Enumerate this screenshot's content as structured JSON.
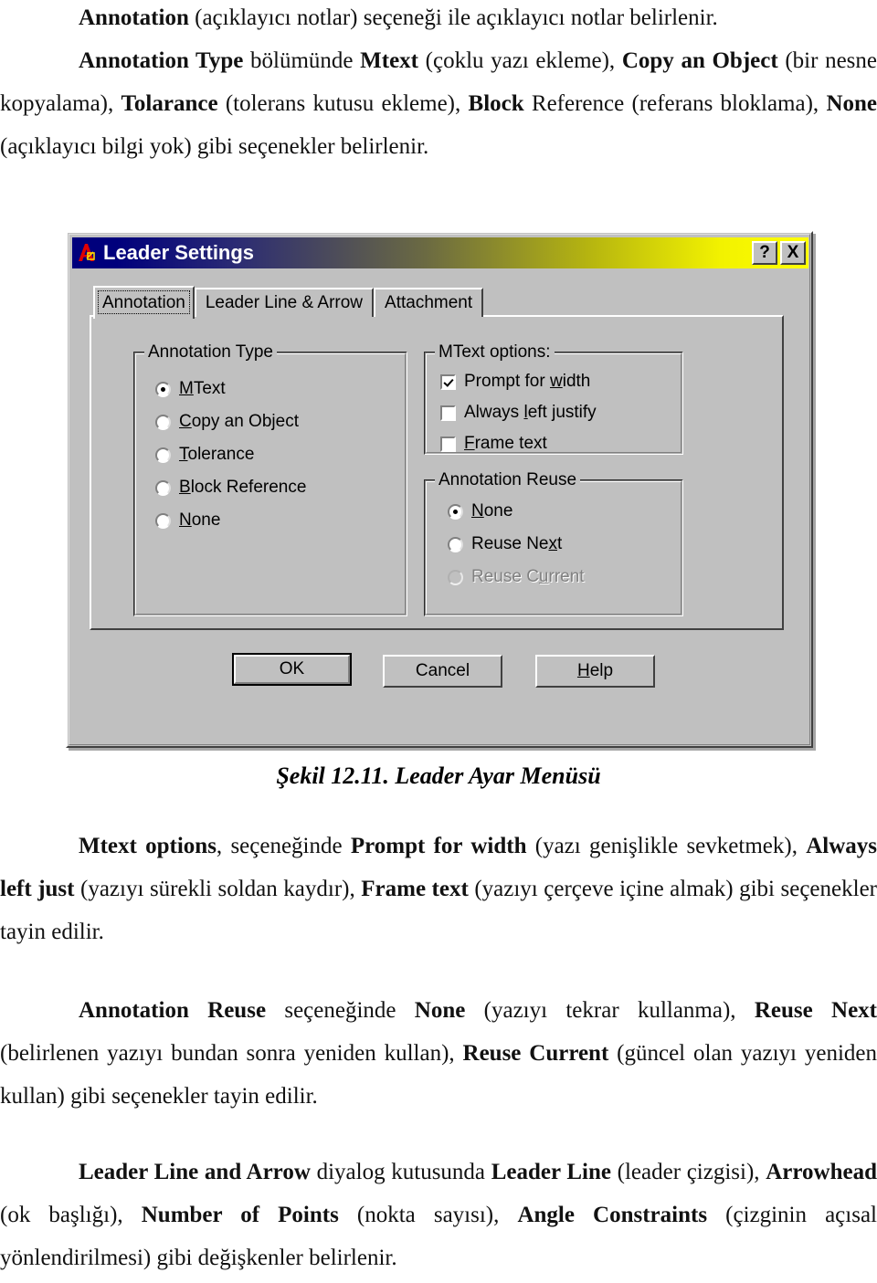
{
  "document": {
    "paragraphs": [
      {
        "id": "p1",
        "runs": [
          {
            "t": "Annotation",
            "b": true
          },
          {
            "t": " (açıklayıcı notlar) seçeneği ile açıklayıcı notlar belirlenir.",
            "b": false
          }
        ]
      },
      {
        "id": "p2",
        "runs": [
          {
            "t": "Annotation Type",
            "b": true
          },
          {
            "t": " bölümünde ",
            "b": false
          },
          {
            "t": "Mtext",
            "b": true
          },
          {
            "t": " (çoklu yazı ekleme), ",
            "b": false
          },
          {
            "t": "Copy an Object",
            "b": true
          },
          {
            "t": " (bir nesne kopyalama), ",
            "b": false
          },
          {
            "t": "Tolarance",
            "b": true
          },
          {
            "t": " (tolerans kutusu ekleme), ",
            "b": false
          },
          {
            "t": "Block",
            "b": true
          },
          {
            "t": " Reference (referans bloklama), ",
            "b": false
          },
          {
            "t": "None",
            "b": true
          },
          {
            "t": " (açıklayıcı bilgi yok) gibi seçenekler belirlenir.",
            "b": false
          }
        ]
      },
      {
        "id": "p3",
        "runs": [
          {
            "t": "Mtext options",
            "b": true
          },
          {
            "t": ", seçeneğinde ",
            "b": false
          },
          {
            "t": "Prompt for width",
            "b": true
          },
          {
            "t": " (yazı genişlikle sevketmek), ",
            "b": false
          },
          {
            "t": "Always left just",
            "b": true
          },
          {
            "t": " (yazıyı sürekli soldan kaydır), ",
            "b": false
          },
          {
            "t": "Frame text",
            "b": true
          },
          {
            "t": " (yazıyı çerçeve içine almak)  gibi seçenekler tayin edilir.",
            "b": false
          }
        ]
      },
      {
        "id": "p4",
        "runs": [
          {
            "t": "Annotation Reuse",
            "b": true
          },
          {
            "t": " seçeneğinde ",
            "b": false
          },
          {
            "t": "None",
            "b": true
          },
          {
            "t": " (yazıyı tekrar kullanma), ",
            "b": false
          },
          {
            "t": "Reuse Next",
            "b": true
          },
          {
            "t": " (belirlenen yazıyı bundan sonra yeniden kullan), ",
            "b": false
          },
          {
            "t": "Reuse Current",
            "b": true
          },
          {
            "t": " (güncel olan yazıyı yeniden kullan) gibi seçenekler tayin edilir.",
            "b": false
          }
        ]
      },
      {
        "id": "p5",
        "runs": [
          {
            "t": "Leader Line and Arrow",
            "b": true
          },
          {
            "t": " diyalog kutusunda ",
            "b": false
          },
          {
            "t": "Leader Line",
            "b": true
          },
          {
            "t": " (leader çizgisi), ",
            "b": false
          },
          {
            "t": "Arrowhead",
            "b": true
          },
          {
            "t": " (ok başlığı), ",
            "b": false
          },
          {
            "t": "Number of Points",
            "b": true
          },
          {
            "t": " (nokta sayısı), ",
            "b": false
          },
          {
            "t": "Angle Constraints",
            "b": true
          },
          {
            "t": " (çizginin açısal yönlendirilmesi) gibi değişkenler belirlenir.",
            "b": false
          }
        ]
      }
    ],
    "figure_caption": "Şekil 12.11. Leader Ayar Menüsü"
  },
  "dialog": {
    "title": "Leader Settings",
    "icon": "autocad-a-logo-icon",
    "title_buttons": [
      {
        "name": "help-button",
        "label": "?"
      },
      {
        "name": "close-button",
        "label": "X"
      }
    ],
    "tabs": [
      {
        "label": "Annotation",
        "active": true
      },
      {
        "label": "Leader Line & Arrow",
        "active": false
      },
      {
        "label": "Attachment",
        "active": false
      }
    ],
    "annotation_type": {
      "legend": "Annotation Type",
      "options": [
        {
          "label": "MText",
          "mnemonic": "M",
          "selected": true,
          "enabled": true
        },
        {
          "label": "Copy an Object",
          "mnemonic": "C",
          "selected": false,
          "enabled": true
        },
        {
          "label": "Tolerance",
          "mnemonic": "T",
          "selected": false,
          "enabled": true
        },
        {
          "label": "Block Reference",
          "mnemonic": "B",
          "selected": false,
          "enabled": true
        },
        {
          "label": "None",
          "mnemonic": "N",
          "selected": false,
          "enabled": true
        }
      ]
    },
    "mtext_options": {
      "legend": "MText options:",
      "options": [
        {
          "label": "Prompt for width",
          "mnemonic": "w",
          "checked": true,
          "enabled": true
        },
        {
          "label": "Always left justify",
          "mnemonic": "l",
          "checked": false,
          "enabled": true
        },
        {
          "label": "Frame text",
          "mnemonic": "F",
          "checked": false,
          "enabled": true
        }
      ]
    },
    "annotation_reuse": {
      "legend": "Annotation Reuse",
      "options": [
        {
          "label": "None",
          "mnemonic": "N",
          "selected": true,
          "enabled": true
        },
        {
          "label": "Reuse Next",
          "mnemonic": "x",
          "selected": false,
          "enabled": true
        },
        {
          "label": "Reuse Current",
          "mnemonic": "u",
          "selected": false,
          "enabled": false
        }
      ]
    },
    "buttons": [
      {
        "name": "ok-button",
        "label": "OK",
        "default": true
      },
      {
        "name": "cancel-button",
        "label": "Cancel",
        "default": false
      },
      {
        "name": "help-dialog-button",
        "label": "Help",
        "default": false,
        "mnemonic": "H"
      }
    ],
    "colors": {
      "face": "#c0c0c0",
      "title_start": "#00007c",
      "title_end": "#ffff00",
      "title_text": "#ffffff",
      "disabled_text": "#808080"
    }
  }
}
